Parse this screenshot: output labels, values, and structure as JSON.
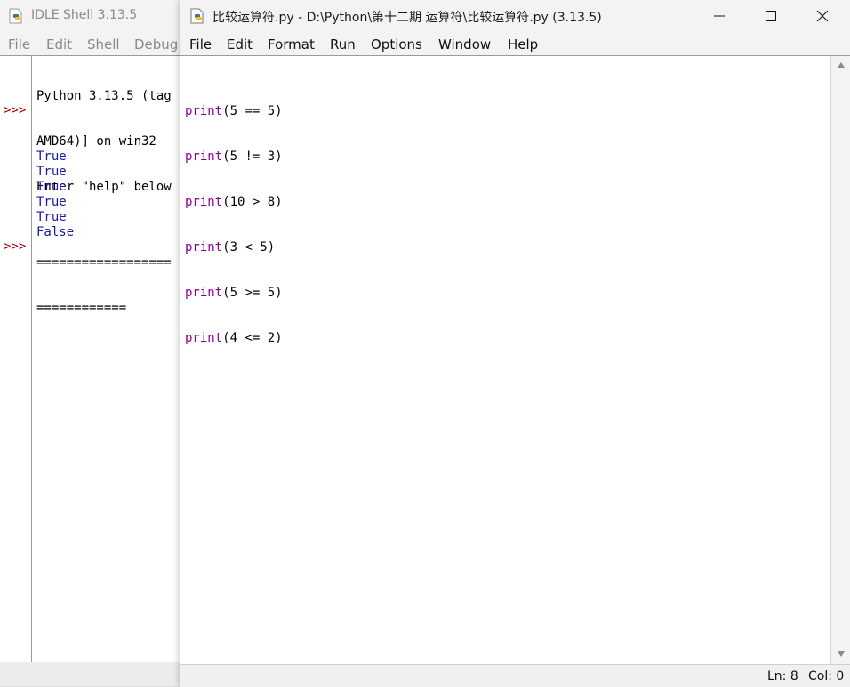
{
  "shell": {
    "title": "IDLE Shell 3.13.5",
    "menu": [
      "File",
      "Edit",
      "Shell",
      "Debug"
    ],
    "lines": [
      "Python 3.13.5 (tag",
      "AMD64)] on win32",
      "Enter \"help\" below",
      "",
      "==================",
      "============"
    ],
    "prompt": ">>>",
    "output": [
      "True",
      "True",
      "True",
      "True",
      "True",
      "False"
    ]
  },
  "editor": {
    "title": "比较运算符.py - D:\\Python\\第十二期 运算符\\比较运算符.py (3.13.5)",
    "menu": [
      "File",
      "Edit",
      "Format",
      "Run",
      "Options",
      "Window",
      "Help"
    ],
    "code": [
      {
        "fn": "print",
        "args": "(5 == 5)"
      },
      {
        "fn": "print",
        "args": "(5 != 3)"
      },
      {
        "fn": "print",
        "args": "(10 > 8)"
      },
      {
        "fn": "print",
        "args": "(3 < 5)"
      },
      {
        "fn": "print",
        "args": "(5 >= 5)"
      },
      {
        "fn": "print",
        "args": "(4 <= 2)"
      }
    ],
    "status": {
      "ln": "Ln: 8",
      "col": "Col: 0"
    }
  },
  "colors": {
    "keyword": "#900090",
    "output": "#1a1aa6",
    "prompt": "#a00000"
  },
  "icons": {
    "app": "python-file-icon",
    "minimize": "minimize-icon",
    "maximize": "maximize-icon",
    "close": "close-icon"
  }
}
